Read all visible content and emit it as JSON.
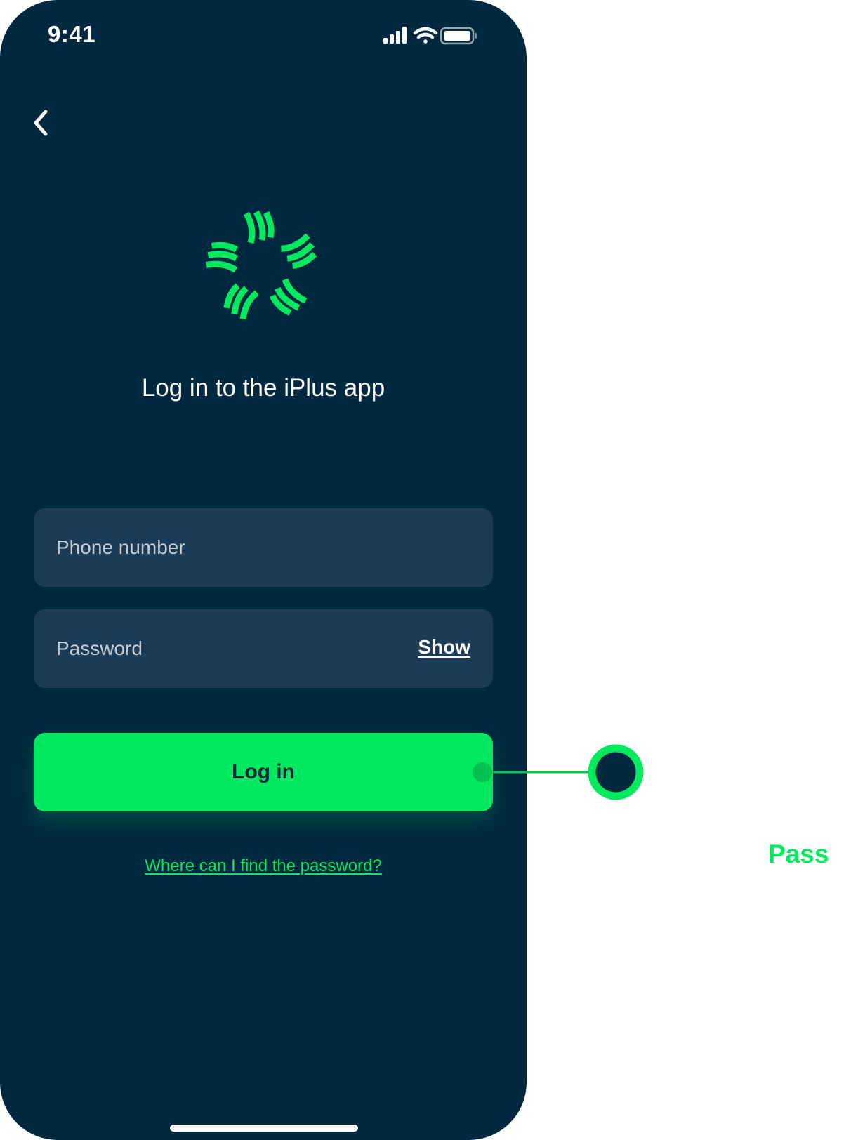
{
  "status_bar": {
    "time": "9:41",
    "icons": [
      "signal-icon",
      "wifi-icon",
      "battery-icon"
    ]
  },
  "nav": {
    "back_icon": "chevron-left-icon"
  },
  "logo": {
    "icon": "iplus-logo-icon",
    "color": "#00e95f"
  },
  "title": "Log in to the iPlus app",
  "form": {
    "phone_placeholder": "Phone number",
    "phone_value": "",
    "password_placeholder": "Password",
    "password_value": "",
    "show_label": "Show",
    "login_label": "Log in",
    "help_link": "Where can I find the password?"
  },
  "annotation": {
    "result": "Pass"
  },
  "colors": {
    "background": "#00283f",
    "field": "#1b3b56",
    "accent": "#00e95f",
    "text": "#ffffff"
  }
}
